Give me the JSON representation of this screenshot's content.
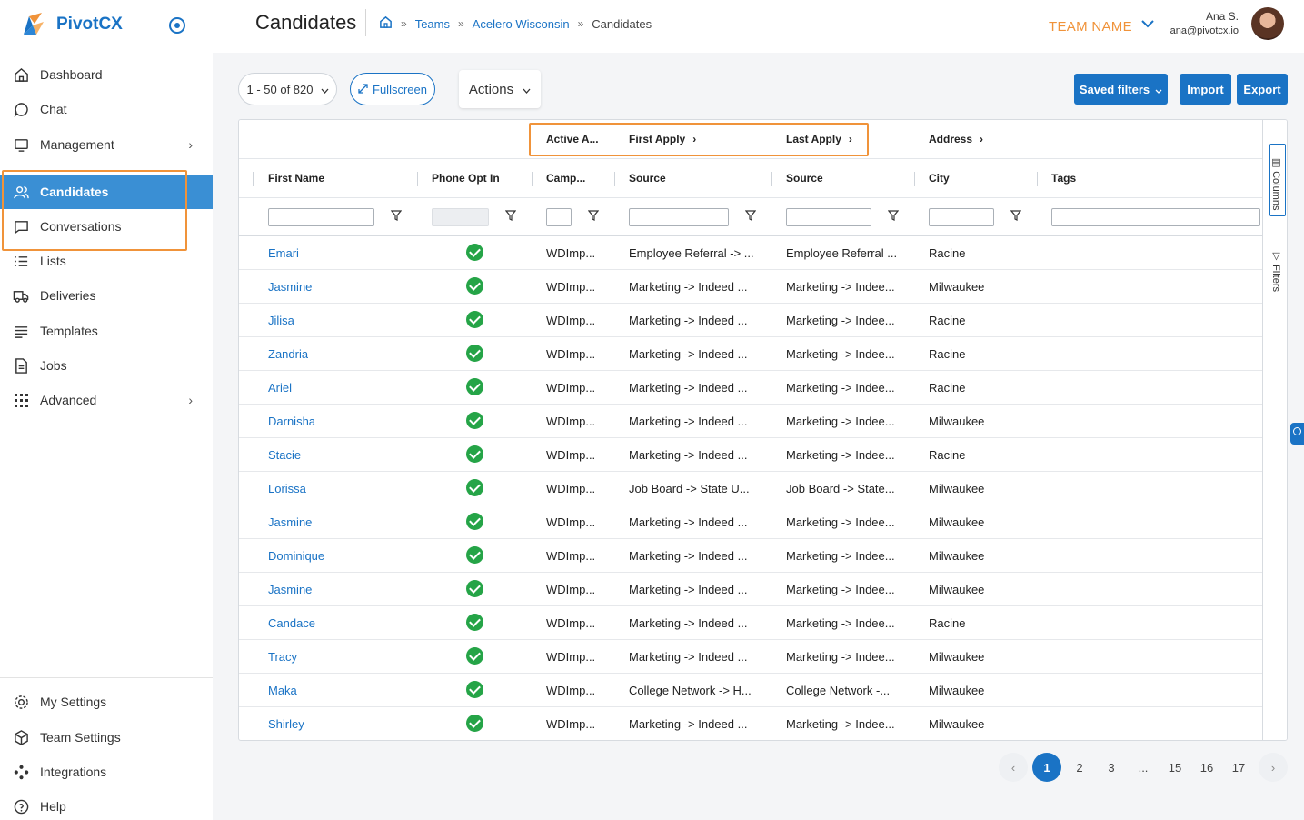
{
  "app": {
    "name": "PivotCX"
  },
  "sidebar": {
    "items": [
      {
        "label": "Dashboard",
        "icon": "home-icon"
      },
      {
        "label": "Chat",
        "icon": "chat-icon"
      },
      {
        "label": "Management",
        "icon": "monitor-icon"
      },
      {
        "label": "Candidates",
        "icon": "users-icon"
      },
      {
        "label": "Conversations",
        "icon": "conversation-icon"
      },
      {
        "label": "Lists",
        "icon": "list-icon"
      },
      {
        "label": "Deliveries",
        "icon": "truck-icon"
      },
      {
        "label": "Templates",
        "icon": "template-icon"
      },
      {
        "label": "Jobs",
        "icon": "document-icon"
      },
      {
        "label": "Advanced",
        "icon": "grid-icon"
      }
    ],
    "bottom_items": [
      {
        "label": "My Settings",
        "icon": "gear-icon"
      },
      {
        "label": "Team Settings",
        "icon": "cube-icon"
      },
      {
        "label": "Integrations",
        "icon": "integrations-icon"
      },
      {
        "label": "Help",
        "icon": "help-icon"
      }
    ]
  },
  "header": {
    "title": "Candidates",
    "breadcrumb": {
      "teams": "Teams",
      "team": "Acelero Wisconsin",
      "current": "Candidates",
      "separator": "»"
    },
    "team_name": "TEAM NAME",
    "user_name": "Ana S.",
    "user_email": "ana@pivotcx.io"
  },
  "toolbar": {
    "range": "1 - 50 of 820",
    "fullscreen": "Fullscreen",
    "actions": "Actions",
    "saved_filters": "Saved filters",
    "import": "Import",
    "export": "Export"
  },
  "grid": {
    "groups": {
      "active": "Active A...",
      "first_apply": "First Apply",
      "last_apply": "Last Apply",
      "address": "Address"
    },
    "columns": {
      "first_name": "First Name",
      "phone_opt_in": "Phone Opt In",
      "campaign": "Camp...",
      "source1": "Source",
      "source2": "Source",
      "city": "City",
      "tags": "Tags"
    },
    "side_tabs": {
      "columns": "Columns",
      "filters": "Filters"
    },
    "rows": [
      {
        "name": "Emari",
        "camp": "WDImp...",
        "src1": "Employee Referral -> ...",
        "src2": "Employee Referral ...",
        "city": "Racine"
      },
      {
        "name": "Jasmine",
        "camp": "WDImp...",
        "src1": "Marketing -> Indeed ...",
        "src2": "Marketing -> Indee...",
        "city": "Milwaukee"
      },
      {
        "name": "Jilisa",
        "camp": "WDImp...",
        "src1": "Marketing -> Indeed ...",
        "src2": "Marketing -> Indee...",
        "city": "Racine"
      },
      {
        "name": "Zandria",
        "camp": "WDImp...",
        "src1": "Marketing -> Indeed ...",
        "src2": "Marketing -> Indee...",
        "city": "Racine"
      },
      {
        "name": "Ariel",
        "camp": "WDImp...",
        "src1": "Marketing -> Indeed ...",
        "src2": "Marketing -> Indee...",
        "city": "Racine"
      },
      {
        "name": "Darnisha",
        "camp": "WDImp...",
        "src1": "Marketing -> Indeed ...",
        "src2": "Marketing -> Indee...",
        "city": "Milwaukee"
      },
      {
        "name": "Stacie",
        "camp": "WDImp...",
        "src1": "Marketing -> Indeed ...",
        "src2": "Marketing -> Indee...",
        "city": "Racine"
      },
      {
        "name": "Lorissa",
        "camp": "WDImp...",
        "src1": "Job Board -> State U...",
        "src2": "Job Board -> State...",
        "city": "Milwaukee"
      },
      {
        "name": "Jasmine",
        "camp": "WDImp...",
        "src1": "Marketing -> Indeed ...",
        "src2": "Marketing -> Indee...",
        "city": "Milwaukee"
      },
      {
        "name": "Dominique",
        "camp": "WDImp...",
        "src1": "Marketing -> Indeed ...",
        "src2": "Marketing -> Indee...",
        "city": "Milwaukee"
      },
      {
        "name": "Jasmine",
        "camp": "WDImp...",
        "src1": "Marketing -> Indeed ...",
        "src2": "Marketing -> Indee...",
        "city": "Milwaukee"
      },
      {
        "name": "Candace",
        "camp": "WDImp...",
        "src1": "Marketing -> Indeed ...",
        "src2": "Marketing -> Indee...",
        "city": "Racine"
      },
      {
        "name": "Tracy",
        "camp": "WDImp...",
        "src1": "Marketing -> Indeed ...",
        "src2": "Marketing -> Indee...",
        "city": "Milwaukee"
      },
      {
        "name": "Maka",
        "camp": "WDImp...",
        "src1": "College Network -> H...",
        "src2": "College Network -...",
        "city": "Milwaukee"
      },
      {
        "name": "Shirley",
        "camp": "WDImp...",
        "src1": "Marketing -> Indeed ...",
        "src2": "Marketing -> Indee...",
        "city": "Milwaukee"
      }
    ]
  },
  "pagination": {
    "prev": "‹",
    "pages": [
      "1",
      "2",
      "3",
      "...",
      "15",
      "16",
      "17"
    ],
    "next": "›",
    "current": "1"
  },
  "colors": {
    "accent": "#1a73c5",
    "active_nav": "#3a8fd4",
    "highlight": "#f0933a",
    "success": "#25a447"
  }
}
